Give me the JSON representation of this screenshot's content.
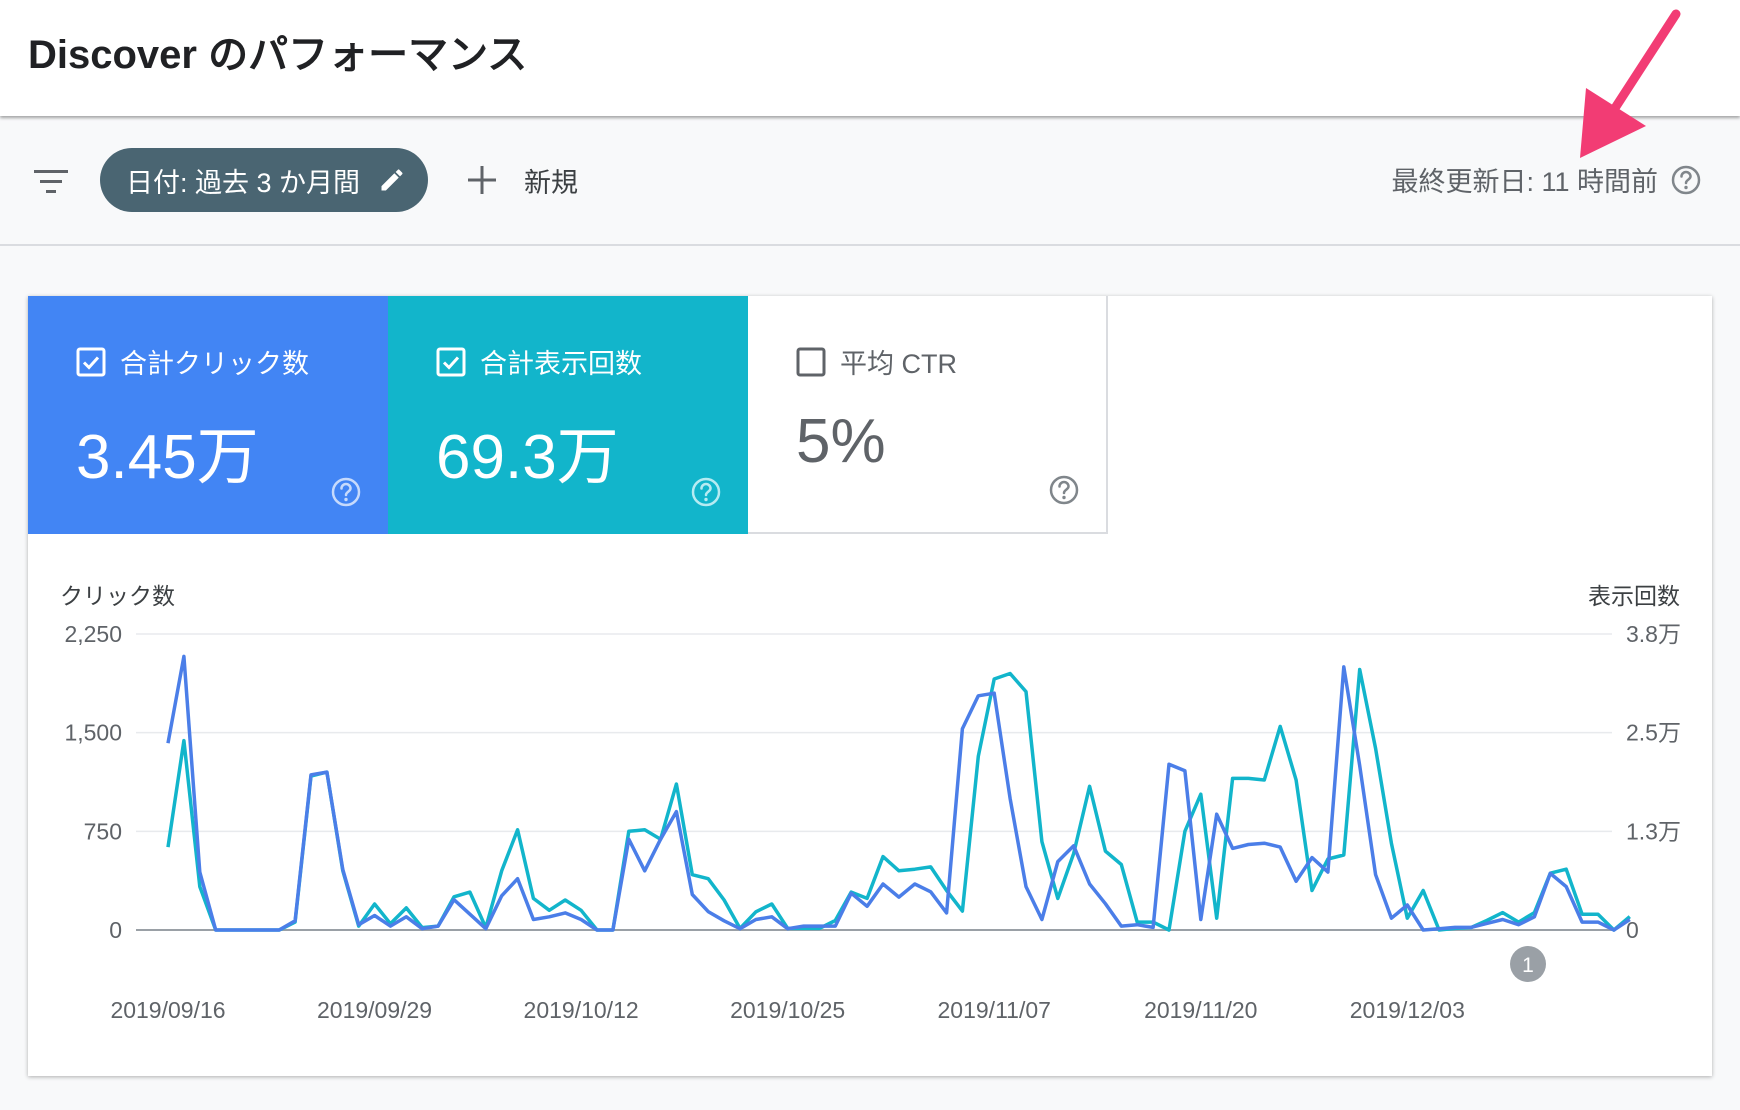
{
  "header": {
    "title": "Discover のパフォーマンス"
  },
  "toolbar": {
    "filter_icon": "filter-list-icon",
    "date_chip_label": "日付: 過去 3 か月間",
    "new_label": "新規",
    "last_updated": "最終更新日: 11 時間前"
  },
  "metrics": [
    {
      "label": "合計クリック数",
      "value": "3.45万",
      "checked": true,
      "color": "#4285f4"
    },
    {
      "label": "合計表示回数",
      "value": "69.3万",
      "checked": true,
      "color": "#12b5cb"
    },
    {
      "label": "平均 CTR",
      "value": "5%",
      "checked": false,
      "color": "#ffffff"
    }
  ],
  "annotation": {
    "label": "1"
  },
  "chart_data": {
    "type": "line",
    "left_axis": {
      "title": "クリック数",
      "ticks": [
        "0",
        "750",
        "1,500",
        "2,250"
      ],
      "tick_values": [
        0,
        750,
        1500,
        2250
      ],
      "range": [
        0,
        2250
      ]
    },
    "right_axis": {
      "title": "表示回数",
      "ticks": [
        "0",
        "1.3万",
        "2.5万",
        "3.8万"
      ],
      "tick_values": [
        0,
        12500,
        25000,
        37500
      ],
      "range": [
        0,
        37500
      ]
    },
    "x_axis": {
      "ticks": [
        "2019/09/16",
        "2019/09/29",
        "2019/10/12",
        "2019/10/25",
        "2019/11/07",
        "2019/11/20",
        "2019/12/03"
      ],
      "tick_positions": [
        0,
        13,
        26,
        39,
        52,
        65,
        78
      ],
      "count": 91
    },
    "grid": true,
    "series": [
      {
        "name": "合計表示回数",
        "axis": "right",
        "color": "#12b5cb",
        "values": [
          10500,
          24000,
          5500,
          0,
          0,
          0,
          0,
          0,
          1000,
          19500,
          20000,
          7500,
          500,
          3300,
          800,
          2800,
          300,
          500,
          4200,
          4800,
          300,
          7500,
          12700,
          4000,
          2500,
          3800,
          2500,
          0,
          0,
          12500,
          12700,
          11500,
          18500,
          7000,
          6500,
          3800,
          200,
          2300,
          3300,
          200,
          200,
          200,
          1200,
          4800,
          4000,
          9300,
          7500,
          7700,
          8000,
          5000,
          2400,
          22000,
          31800,
          32500,
          30200,
          11200,
          4000,
          9700,
          18200,
          10000,
          8300,
          1000,
          1000,
          0,
          12500,
          17200,
          1500,
          19200,
          19200,
          19000,
          25800,
          19000,
          5000,
          9000,
          9500,
          33000,
          23000,
          11000,
          1500,
          5000,
          0,
          200,
          300,
          1200,
          2200,
          1000,
          2200,
          7200,
          7700,
          2000,
          2000,
          0,
          1700
        ]
      },
      {
        "name": "合計クリック数",
        "axis": "left",
        "color": "#4b7ee8",
        "values": [
          1420,
          2080,
          440,
          0,
          0,
          0,
          0,
          0,
          70,
          1180,
          1200,
          460,
          40,
          110,
          30,
          100,
          10,
          30,
          230,
          120,
          10,
          260,
          390,
          80,
          100,
          130,
          80,
          0,
          0,
          690,
          450,
          690,
          900,
          270,
          140,
          70,
          10,
          80,
          100,
          10,
          30,
          30,
          30,
          280,
          180,
          350,
          250,
          350,
          290,
          130,
          1530,
          1780,
          1800,
          1000,
          330,
          80,
          520,
          640,
          350,
          200,
          30,
          40,
          20,
          1260,
          1210,
          80,
          880,
          620,
          650,
          660,
          630,
          370,
          550,
          440,
          2000,
          1250,
          420,
          90,
          190,
          0,
          10,
          20,
          20,
          50,
          80,
          40,
          100,
          430,
          330,
          60,
          60,
          0,
          80
        ]
      }
    ]
  }
}
